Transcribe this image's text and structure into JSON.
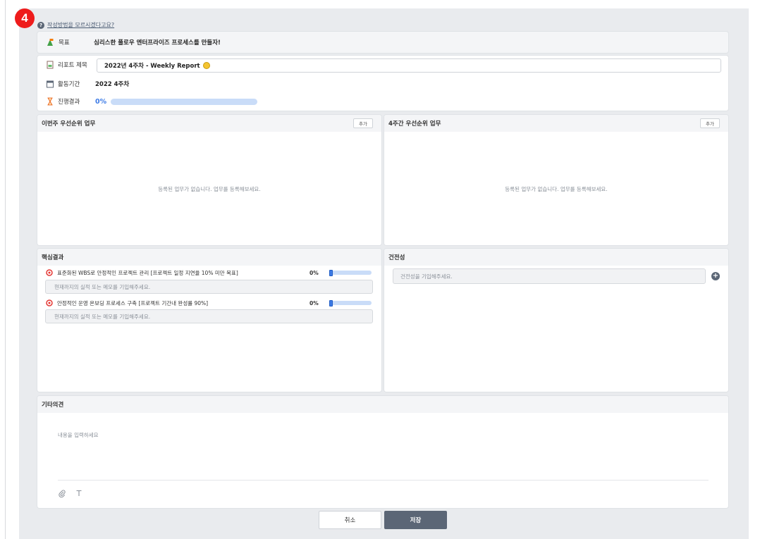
{
  "step_badge": "4",
  "help_link": "작성방법을 모르시겠다고요?",
  "goal": {
    "label": "목표",
    "value": "심리스한 풀로우 엔터프라이즈 프로세스를 만들자!"
  },
  "report": {
    "title_label": "리포트 제목",
    "title_value": "2022년 4주차 - Weekly Report",
    "period_label": "활동기간",
    "period_value": "2022  4주차",
    "progress_label": "진행결과",
    "progress_value": "0%",
    "progress_fraction": 0
  },
  "this_week": {
    "title": "이번주 우선순위 업무",
    "add_label": "추가",
    "empty_message": "등록된 업무가 없습니다. 업무를 등록해보세요."
  },
  "four_week": {
    "title": "4주간 우선순위 업무",
    "add_label": "추가",
    "empty_message": "등록된 업무가 없습니다. 업무를 등록해보세요."
  },
  "key_results": {
    "title": "핵심결과",
    "memo_placeholder": "현재까지의 실적 또는 메모를 기입해주세요.",
    "items": [
      {
        "text": "표준화된 WBS로 안정적인 프로젝트 관리 [프로젝트 일정 지연율 10% 미만 목표]",
        "percent": "0%"
      },
      {
        "text": "안정적인 운영 온보딩 프로세스 구축 [프로젝트 기간내 완성률 90%]",
        "percent": "0%"
      }
    ]
  },
  "health": {
    "title": "건전성",
    "placeholder": "건전성을 기입해주세요."
  },
  "etc": {
    "title": "기타의견",
    "placeholder": "내용을 입력하세요"
  },
  "buttons": {
    "cancel": "취소",
    "save": "저장"
  },
  "colors": {
    "accent": "#3d7be6",
    "badge": "#ee1c1c",
    "save_button": "#5b6676"
  }
}
